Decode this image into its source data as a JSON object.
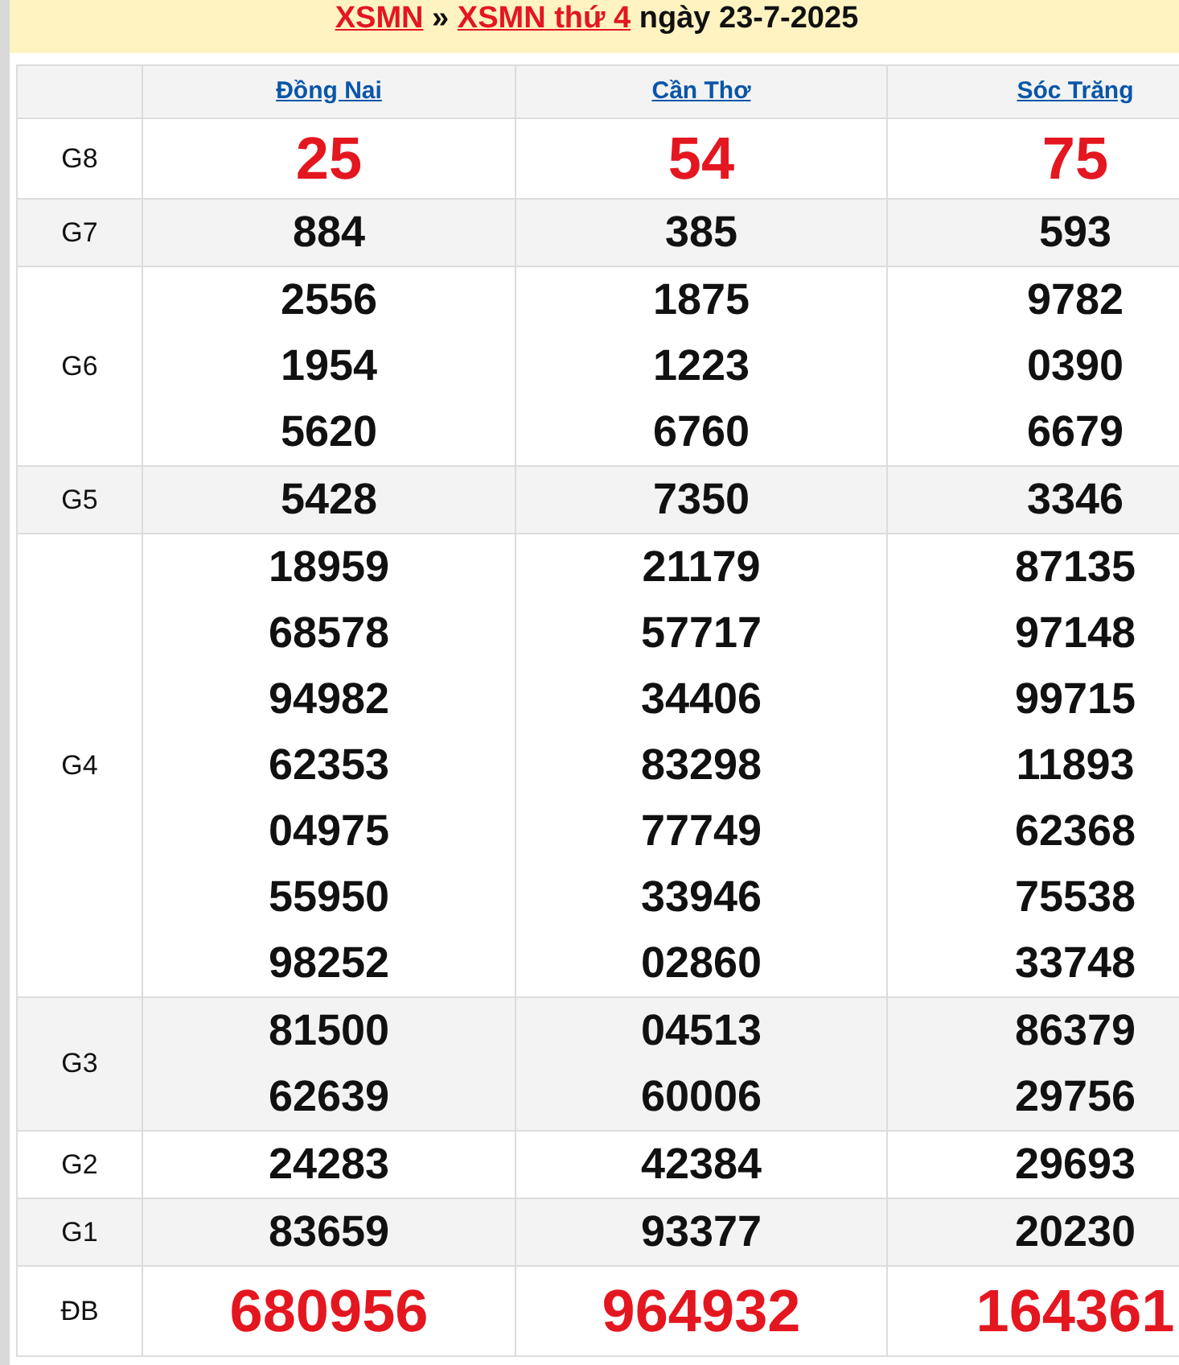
{
  "breadcrumb": {
    "links": [
      "XSMN",
      "XSMN thứ 4"
    ],
    "separator": "»",
    "date_text": "ngày 23-7-2025"
  },
  "provinces": [
    "Đồng Nai",
    "Cần Thơ",
    "Sóc Trăng"
  ],
  "prizes": [
    {
      "label": "G8",
      "highlight": true,
      "results": [
        [
          "25"
        ],
        [
          "54"
        ],
        [
          "75"
        ]
      ]
    },
    {
      "label": "G7",
      "highlight": false,
      "results": [
        [
          "884"
        ],
        [
          "385"
        ],
        [
          "593"
        ]
      ]
    },
    {
      "label": "G6",
      "highlight": false,
      "results": [
        [
          "2556",
          "1954",
          "5620"
        ],
        [
          "1875",
          "1223",
          "6760"
        ],
        [
          "9782",
          "0390",
          "6679"
        ]
      ]
    },
    {
      "label": "G5",
      "highlight": false,
      "results": [
        [
          "5428"
        ],
        [
          "7350"
        ],
        [
          "3346"
        ]
      ]
    },
    {
      "label": "G4",
      "highlight": false,
      "results": [
        [
          "18959",
          "68578",
          "94982",
          "62353",
          "04975",
          "55950",
          "98252"
        ],
        [
          "21179",
          "57717",
          "34406",
          "83298",
          "77749",
          "33946",
          "02860"
        ],
        [
          "87135",
          "97148",
          "99715",
          "11893",
          "62368",
          "75538",
          "33748"
        ]
      ]
    },
    {
      "label": "G3",
      "highlight": false,
      "results": [
        [
          "81500",
          "62639"
        ],
        [
          "04513",
          "60006"
        ],
        [
          "86379",
          "29756"
        ]
      ]
    },
    {
      "label": "G2",
      "highlight": false,
      "results": [
        [
          "24283"
        ],
        [
          "42384"
        ],
        [
          "29693"
        ]
      ]
    },
    {
      "label": "G1",
      "highlight": false,
      "results": [
        [
          "83659"
        ],
        [
          "93377"
        ],
        [
          "20230"
        ]
      ]
    },
    {
      "label": "ĐB",
      "highlight": true,
      "results": [
        [
          "680956"
        ],
        [
          "964932"
        ],
        [
          "164361"
        ]
      ]
    }
  ]
}
